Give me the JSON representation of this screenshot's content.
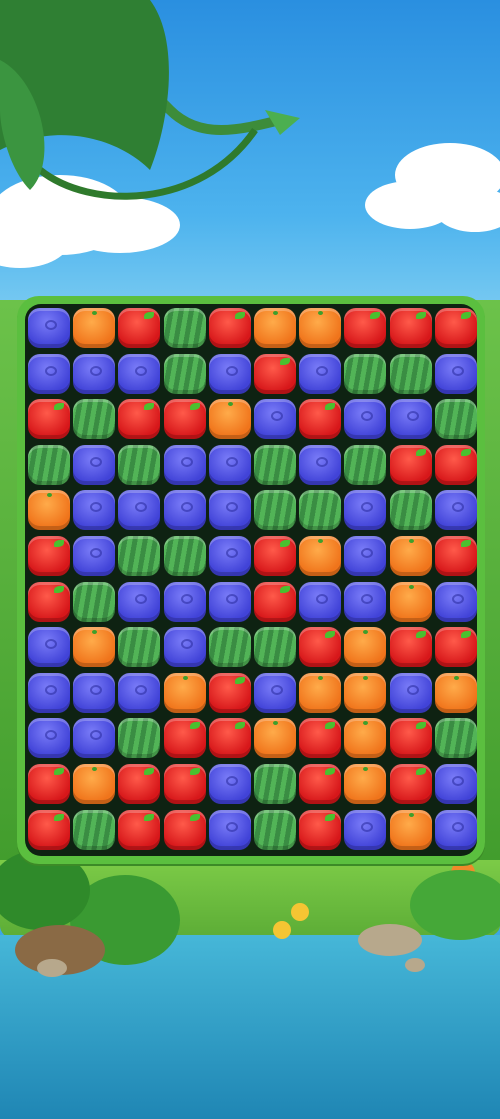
{
  "game": {
    "title": "",
    "colors": {
      "blueberry": "#4a4ce6",
      "orange": "#f58a24",
      "apple": "#e0221f",
      "watermelon": "#49a64f",
      "board_frame": "#5bbf3f",
      "board_bg": "#0e2212"
    },
    "legend_icons": [
      "blueberry-icon",
      "orange-icon",
      "apple-icon",
      "watermelon-icon"
    ],
    "board": {
      "rows": 12,
      "cols": 10,
      "tiles": [
        [
          "blueberry",
          "orange",
          "apple",
          "watermelon",
          "apple",
          "orange",
          "orange",
          "apple",
          "apple",
          "apple"
        ],
        [
          "blueberry",
          "blueberry",
          "blueberry",
          "watermelon",
          "blueberry",
          "apple",
          "blueberry",
          "watermelon",
          "watermelon",
          "blueberry"
        ],
        [
          "apple",
          "watermelon",
          "apple",
          "apple",
          "orange",
          "blueberry",
          "apple",
          "blueberry",
          "blueberry",
          "watermelon"
        ],
        [
          "watermelon",
          "blueberry",
          "watermelon",
          "blueberry",
          "blueberry",
          "watermelon",
          "blueberry",
          "watermelon",
          "apple",
          "apple"
        ],
        [
          "orange",
          "blueberry",
          "blueberry",
          "blueberry",
          "blueberry",
          "watermelon",
          "watermelon",
          "blueberry",
          "watermelon",
          "blueberry"
        ],
        [
          "apple",
          "blueberry",
          "watermelon",
          "watermelon",
          "blueberry",
          "apple",
          "orange",
          "blueberry",
          "orange",
          "apple"
        ],
        [
          "apple",
          "watermelon",
          "blueberry",
          "blueberry",
          "blueberry",
          "apple",
          "blueberry",
          "blueberry",
          "orange",
          "blueberry"
        ],
        [
          "blueberry",
          "orange",
          "watermelon",
          "blueberry",
          "watermelon",
          "watermelon",
          "apple",
          "orange",
          "apple",
          "apple"
        ],
        [
          "blueberry",
          "blueberry",
          "blueberry",
          "orange",
          "apple",
          "blueberry",
          "orange",
          "orange",
          "blueberry",
          "orange"
        ],
        [
          "blueberry",
          "blueberry",
          "watermelon",
          "apple",
          "apple",
          "orange",
          "apple",
          "orange",
          "apple",
          "watermelon"
        ],
        [
          "apple",
          "orange",
          "apple",
          "apple",
          "blueberry",
          "watermelon",
          "apple",
          "orange",
          "apple",
          "blueberry"
        ],
        [
          "apple",
          "watermelon",
          "apple",
          "apple",
          "blueberry",
          "watermelon",
          "apple",
          "blueberry",
          "orange",
          "blueberry"
        ]
      ]
    }
  }
}
